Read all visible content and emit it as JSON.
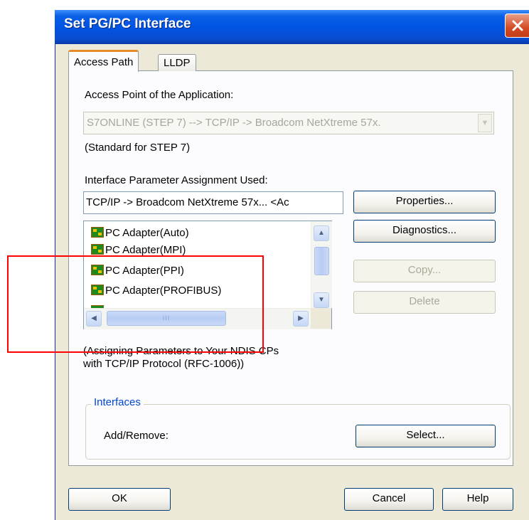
{
  "window": {
    "title": "Set PG/PC Interface"
  },
  "tabs": [
    {
      "label": "Access Path",
      "active": true
    },
    {
      "label": "LLDP",
      "active": false
    }
  ],
  "access_point": {
    "label": "Access Point of the Application:",
    "value": "S7ONLINE     (STEP 7)     --> TCP/IP -> Broadcom NetXtreme 57x.",
    "note": "(Standard for STEP 7)"
  },
  "interface_param": {
    "label": "Interface Parameter Assignment Used:",
    "value": "TCP/IP -> Broadcom NetXtreme 57x...  <Ac",
    "list": [
      "PC Adapter(Auto)",
      "PC Adapter(MPI)",
      "PC Adapter(PPI)",
      "PC Adapter(PROFIBUS)"
    ],
    "description_line1": "(Assigning Parameters to Your NDIS CPs",
    "description_line2": "with TCP/IP Protocol (RFC-1006))"
  },
  "buttons": {
    "properties": "Properties...",
    "diagnostics": "Diagnostics...",
    "copy": "Copy...",
    "delete": "Delete",
    "select": "Select...",
    "ok": "OK",
    "cancel": "Cancel",
    "help": "Help"
  },
  "interfaces_group": {
    "title": "Interfaces",
    "add_remove_label": "Add/Remove:"
  },
  "scroll_glyphs": {
    "grip": "III"
  },
  "colors": {
    "title_bar": "#0054e3",
    "highlight_box": "#ff0000",
    "group_title": "#0046d5"
  }
}
